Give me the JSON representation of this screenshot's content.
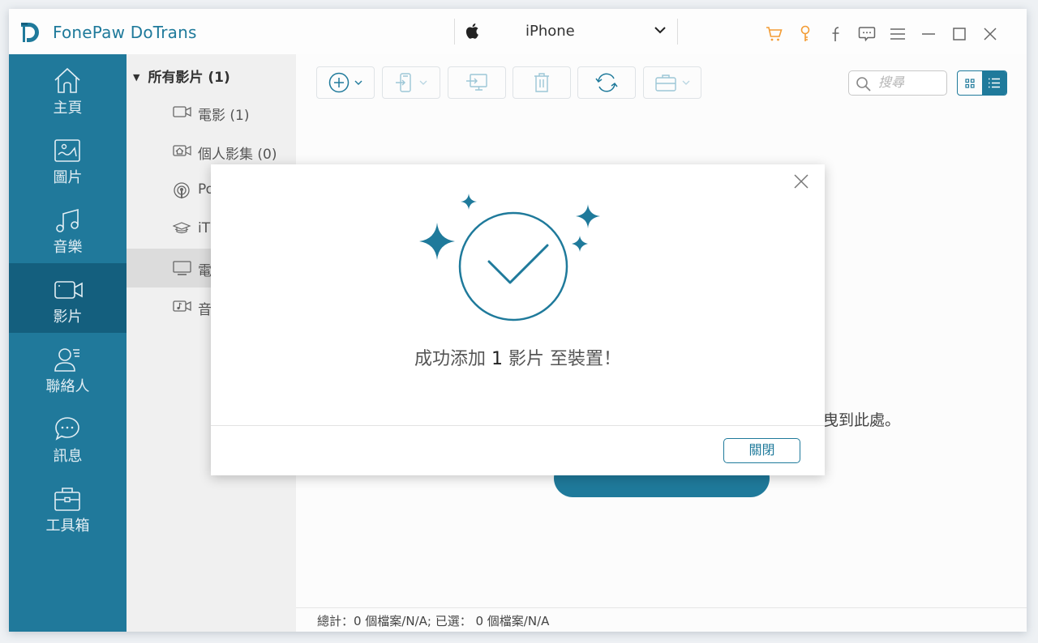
{
  "app": {
    "title": "FonePaw DoTrans",
    "device": "iPhone",
    "brand_color": "#1f7a9b",
    "accent_orange": "#f39c34"
  },
  "titlebar_icons": [
    {
      "name": "cart-icon",
      "color": "#f39c34"
    },
    {
      "name": "key-icon",
      "color": "#f39c34"
    },
    {
      "name": "facebook-icon",
      "color": "#666666"
    },
    {
      "name": "feedback-icon",
      "color": "#666666"
    },
    {
      "name": "menu-icon",
      "color": "#666666"
    },
    {
      "name": "minimize-icon",
      "color": "#666666"
    },
    {
      "name": "maximize-icon",
      "color": "#666666"
    },
    {
      "name": "close-icon",
      "color": "#666666"
    }
  ],
  "sidebar": {
    "items": [
      {
        "label": "主頁",
        "icon": "home-icon",
        "active": false
      },
      {
        "label": "圖片",
        "icon": "photo-icon",
        "active": false
      },
      {
        "label": "音樂",
        "icon": "music-icon",
        "active": false
      },
      {
        "label": "影片",
        "icon": "video-icon",
        "active": true
      },
      {
        "label": "聯絡人",
        "icon": "contacts-icon",
        "active": false
      },
      {
        "label": "訊息",
        "icon": "message-icon",
        "active": false
      },
      {
        "label": "工具箱",
        "icon": "toolbox-icon",
        "active": false
      }
    ]
  },
  "subnav": {
    "header": "所有影片 (1)",
    "items": [
      {
        "label": "電影 (1)",
        "icon": "movie-icon",
        "active": false
      },
      {
        "label": "個人影集 (0)",
        "icon": "home-video-icon",
        "active": false
      },
      {
        "label": "Po",
        "icon": "podcast-icon",
        "active": false
      },
      {
        "label": "iT",
        "icon": "itunes-u-icon",
        "active": false
      },
      {
        "label": "電",
        "icon": "tv-icon",
        "active": true
      },
      {
        "label": "音",
        "icon": "music-video-icon",
        "active": false
      }
    ]
  },
  "toolbar": {
    "buttons": [
      {
        "name": "add-button",
        "icon": "plus-circle-icon",
        "dropdown": true
      },
      {
        "name": "export-to-device-button",
        "icon": "export-device-icon",
        "dropdown": true
      },
      {
        "name": "export-to-pc-button",
        "icon": "export-pc-icon",
        "dropdown": false
      },
      {
        "name": "delete-button",
        "icon": "trash-icon",
        "dropdown": false
      },
      {
        "name": "sync-button",
        "icon": "refresh-icon",
        "dropdown": false
      },
      {
        "name": "toolbox-button",
        "icon": "briefcase-icon",
        "dropdown": true
      }
    ],
    "search_placeholder": "搜尋"
  },
  "main": {
    "drop_hint": "曳到此處。"
  },
  "statusbar": {
    "text": "總計：0 個檔案/N/A; 已選： 0 個檔案/N/A"
  },
  "dialog": {
    "msg_prefix": "成功添加",
    "msg_count": "1",
    "msg_suffix": "影片  至裝置！",
    "close_button": "關閉"
  }
}
